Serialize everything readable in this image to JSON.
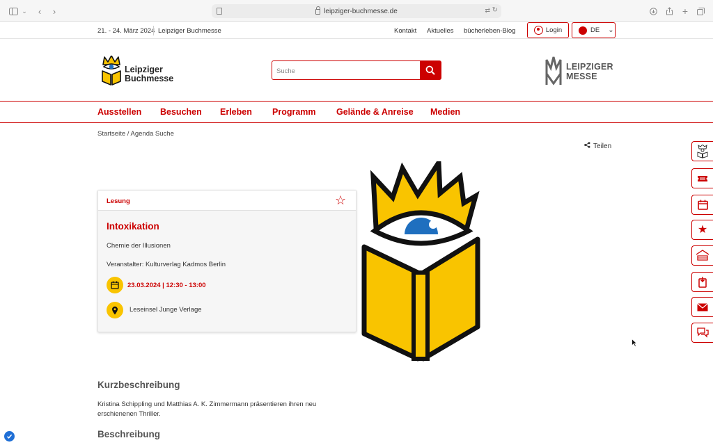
{
  "browser": {
    "url": "leipziger-buchmesse.de"
  },
  "topbar": {
    "date": "21. - 24. März 2024",
    "event": "Leipziger Buchmesse",
    "links": [
      "Kontakt",
      "Aktuelles",
      "bücherleben-Blog"
    ],
    "login_label": "Login",
    "lang_label": "DE"
  },
  "header": {
    "logo_line1": "Leipziger",
    "logo_line2": "Buchmesse",
    "search_placeholder": "Suche",
    "partner_line1": "LEIPZIGER",
    "partner_line2": "MESSE"
  },
  "nav": {
    "items": [
      "Ausstellen",
      "Besuchen",
      "Erleben",
      "Programm",
      "Gelände & Anreise",
      "Medien"
    ]
  },
  "breadcrumb": "Startseite / Agenda Suche",
  "share_label": "Teilen",
  "event": {
    "category": "Lesung",
    "title": "Intoxikation",
    "subtitle": "Chemie der Illusionen",
    "organizer": "Veranstalter: Kulturverlag Kadmos Berlin",
    "datetime": "23.03.2024 | 12:30 - 13:00",
    "location": "Leseinsel Junge Verlage"
  },
  "sections": {
    "short_heading": "Kurzbeschreibung",
    "short_text": "Kristina Schippling und Matthias A. K. Zimmermann präsentieren ihren neu erschienenen Thriller.",
    "long_heading": "Beschreibung"
  },
  "side_icons": [
    "book-reader-icon",
    "ticket-icon",
    "calendar-icon",
    "star-icon",
    "hotel-bed-icon",
    "download-app-icon",
    "mail-icon",
    "chat-icon"
  ],
  "colors": {
    "brand_red": "#cc0000",
    "brand_yellow": "#f9c400",
    "eye_blue": "#1f6fbf"
  }
}
